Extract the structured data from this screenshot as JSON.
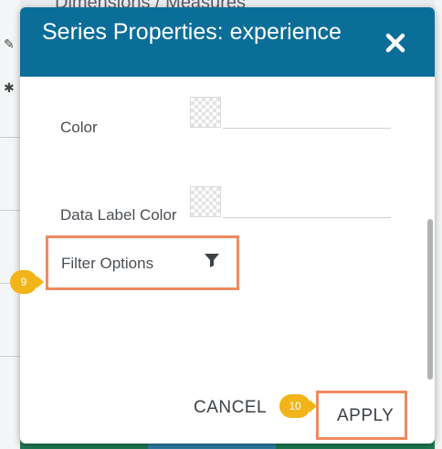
{
  "background": {
    "top_text": "Dimensions / Measures"
  },
  "dialog": {
    "title": "Series Properties: experience",
    "properties": {
      "color_label": "Color",
      "data_label_color_label": "Data Label Color",
      "filter_options_label": "Filter Options"
    },
    "icons": {
      "close": "close-icon",
      "filter": "filter-icon"
    },
    "buttons": {
      "cancel_label": "CANCEL",
      "apply_label": "APPLY"
    },
    "callouts": {
      "step_9": "9",
      "step_10": "10"
    }
  },
  "colors": {
    "header": "#0b6e99",
    "highlight_border": "#ef8a5e",
    "badge": "#f2b418"
  }
}
